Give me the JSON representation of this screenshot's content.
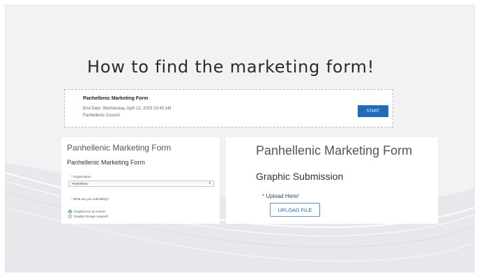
{
  "slide": {
    "title": "How to find the marketing form!"
  },
  "form_card": {
    "name": "Panhellenic Marketing Form",
    "end_date": "End Date: Wednesday, April 12, 2023 10:45 AM",
    "organization": "Panhellenic Council",
    "start_label": "START"
  },
  "left_form": {
    "header": "Panhellenic Marketing Form",
    "subheader": "Panhellenic Marketing Form",
    "organization_label": "Organization",
    "organization_value": "Panhellenic",
    "question_label": "What are you submitting?",
    "options": [
      {
        "label": "Graphics for an event?",
        "selected": true
      },
      {
        "label": "Graphic Design request?",
        "selected": false
      }
    ],
    "required_mark": "*"
  },
  "right_form": {
    "header": "Panhellenic Marketing Form",
    "section": "Graphic Submission",
    "upload_label": "Upload Here!",
    "required_mark": "*",
    "upload_button": "UPLOAD FILE"
  },
  "colors": {
    "accent": "#1f6bb8",
    "slide_bg": "#f2f1f3",
    "required": "#dd3333"
  }
}
